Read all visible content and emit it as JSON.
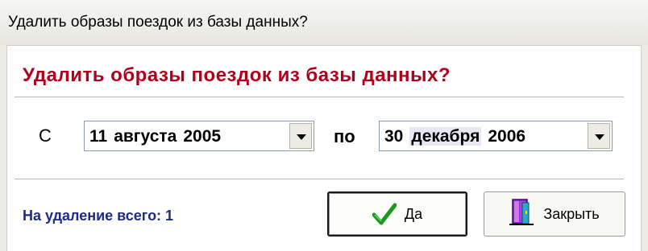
{
  "window": {
    "title": "Удалить образы поездок из базы данных?"
  },
  "dialog": {
    "heading": "Удалить образы поездок из базы данных?",
    "from_label": "С",
    "to_label": "по",
    "date_from": {
      "day": "11",
      "month": "августа",
      "year": "2005"
    },
    "date_to": {
      "day": "30",
      "month": "декабря",
      "year": "2006"
    },
    "total_text": "На удаление всего: 1",
    "buttons": {
      "yes_label": "Да",
      "close_label": "Закрыть"
    }
  },
  "icons": {
    "yes": "checkmark-icon",
    "close": "door-exit-icon",
    "dropdown": "chevron-down-icon"
  },
  "colors": {
    "heading": "#b0001c",
    "total_text": "#1d2a8a",
    "checkmark": "#1a9a1a"
  }
}
